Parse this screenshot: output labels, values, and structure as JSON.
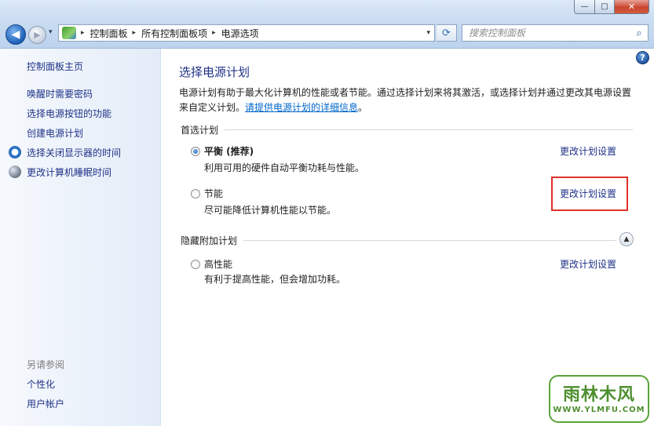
{
  "window": {
    "minimize_glyph": "—",
    "maximize_glyph": "□",
    "close_glyph": "✕"
  },
  "address_bar": {
    "icon": "control-panel-icon",
    "crumbs": [
      "控制面板",
      "所有控制面板项",
      "电源选项"
    ],
    "separator": "▸",
    "dropdown_glyph": "▾",
    "refresh_glyph": "⟳"
  },
  "search": {
    "placeholder": "搜索控制面板",
    "icon": "magnifier-icon"
  },
  "sidebar": {
    "home": "控制面板主页",
    "links": [
      {
        "label": "唤醒时需要密码"
      },
      {
        "label": "选择电源按钮的功能"
      },
      {
        "label": "创建电源计划"
      },
      {
        "label": "选择关闭显示器的时间",
        "icon": "clock-monitor-icon"
      },
      {
        "label": "更改计算机睡眠时间",
        "icon": "moon-icon"
      }
    ],
    "see_also_heading": "另请参阅",
    "see_also": [
      "个性化",
      "用户帐户"
    ]
  },
  "main": {
    "title": "选择电源计划",
    "description": "电源计划有助于最大化计算机的性能或者节能。通过选择计划来将其激活，或选择计划并通过更改其电源设置来自定义计划。",
    "description_link": "请提供电源计划的详细信息",
    "description_end": "。",
    "preferred_heading": "首选计划",
    "hidden_heading": "隐藏附加计划",
    "change_link": "更改计划设置",
    "plans": [
      {
        "name": "平衡 (推荐)",
        "desc": "利用可用的硬件自动平衡功耗与性能。",
        "selected": true
      },
      {
        "name": "节能",
        "desc": "尽可能降低计算机性能以节能。",
        "selected": false
      },
      {
        "name": "高性能",
        "desc": "有利于提高性能，但会增加功耗。",
        "selected": false
      }
    ],
    "highlight_color": "#e0302a"
  },
  "watermark": {
    "main": "雨林木风",
    "sub": "WWW.YLMFU.COM"
  }
}
